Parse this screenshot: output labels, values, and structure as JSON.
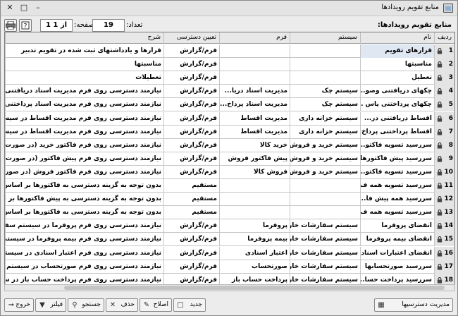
{
  "window": {
    "title": "منابع تقویم رویدادها"
  },
  "toolbar": {
    "form_caption": "منابع تقویم رویدادها:",
    "count_label": "تعداد:",
    "count_value": "19",
    "page_label": "صفحه:",
    "page_value": "1 از 1"
  },
  "columns": [
    "ردیف",
    "نام",
    "سیستم",
    "فرم",
    "تعیین دسترسی",
    "شرح"
  ],
  "rows": [
    {
      "idx": "1",
      "name": "قرارهای تقویم",
      "system": "",
      "form": "",
      "access": "فرم/گزارش",
      "desc": "قرارها و یادداشتهای ثبت شده در تقویم تدبیر"
    },
    {
      "idx": "2",
      "name": "مناسبتها",
      "system": "",
      "form": "",
      "access": "فرم/گزارش",
      "desc": "مناسبتها"
    },
    {
      "idx": "3",
      "name": "تعطیل",
      "system": "",
      "form": "",
      "access": "فرم/گزارش",
      "desc": "تعطیلات"
    },
    {
      "idx": "4",
      "name": "چکهای دریافتنی وصو...",
      "system": "سیستم چک",
      "form": "مدیریت اسناد دریا...",
      "access": "فرم/گزارش",
      "desc": "نیازمند دسترسی روی فرم مدیریت اسناد دریافتنی در سیستم چک"
    },
    {
      "idx": "5",
      "name": "چکهای پرداختنی پاس ...",
      "system": "سیستم چک",
      "form": "مدیریت اسناد پرداخ...",
      "access": "فرم/گزارش",
      "desc": "نیازمند دسترسی روی فرم مدیریت اسناد پرداختنی در سیستم چک"
    },
    {
      "idx": "6",
      "name": "اقساط دریافتنی در...",
      "system": "سیستم خزانه داری",
      "form": "مدیریت اقساط",
      "access": "فرم/گزارش",
      "desc": "نیازمند دسترسی روی فرم مدیریت اقساط در سیستم خزانه داری"
    },
    {
      "idx": "7",
      "name": "اقساط پرداختنی پرداخ...",
      "system": "سیستم خزانه داری",
      "form": "مدیریت اقساط",
      "access": "فرم/گزارش",
      "desc": "نیازمند دسترسی روی فرم مدیریت اقساط در سیستم خزانه داری"
    },
    {
      "idx": "8",
      "name": "سررسید تسویه فاکتو...",
      "system": "سیستم خرید و فروش",
      "form": "خرید کالا",
      "access": "فرم/گزارش",
      "desc": "نیازمند دسترسی روی فرم فاکتور خرید (در صورت فعال بودن گزینه"
    },
    {
      "idx": "9",
      "name": "سررسید پیش فاکتورها",
      "system": "سیستم خرید و فروش",
      "form": "پیش فاکتور فروش",
      "access": "فرم/گزارش",
      "desc": "نیازمند دسترسی روی فرم پیش فاکتور (در صورت فعال بودن گزینه"
    },
    {
      "idx": "10",
      "name": "سررسید تسویه فاکتو...",
      "system": "سیستم خرید و فروش",
      "form": "فروش کالا",
      "access": "فرم/گزارش",
      "desc": "نیازمند دسترسی روی فرم فاکتور فروش (در صورت فعال بودن گز"
    },
    {
      "idx": "11",
      "name": "سررسید تسویه همه ف...",
      "system": "",
      "form": "",
      "access": "مستقیم",
      "desc": "بدون توجه به گزینه دسترسی به فاکتورها بر اساس کاربر"
    },
    {
      "idx": "12",
      "name": "سررسید همه پیش فا...",
      "system": "",
      "form": "",
      "access": "مستقیم",
      "desc": "بدون توجه به گزینه دسترسی به پیش فاکتورها بر اساس کاربر"
    },
    {
      "idx": "13",
      "name": "سررسید تسویه همه ف...",
      "system": "",
      "form": "",
      "access": "مستقیم",
      "desc": "بدون توجه به گزینه دسترسی به فاکتورها بر اساس کاربر"
    },
    {
      "idx": "14",
      "name": "انقضای پروفرما",
      "system": "سیستم سفارشات خارجی",
      "form": "پروفرما",
      "access": "فرم/گزارش",
      "desc": "نیازمند دسترسی روی فرم پروفرما در سیستم سفارشات خارجی"
    },
    {
      "idx": "15",
      "name": "انقضای بیمه پروفرما",
      "system": "سیستم سفارشات خارجی",
      "form": "بیمه پروفرما",
      "access": "فرم/گزارش",
      "desc": "نیازمند دسترسی روی فرم بیمه پروفرما در سیستم سفارشات خارجی"
    },
    {
      "idx": "16",
      "name": "انقضای اعتبارات اسنادی",
      "system": "سیستم سفارشات خارجی",
      "form": "اعتبار اسنادی",
      "access": "فرم/گزارش",
      "desc": "نیازمند دسترسی روی فرم اعتبار اسنادی در سیستم سفارشات خار"
    },
    {
      "idx": "17",
      "name": "سررسید صورتحسابها",
      "system": "سیستم سفارشات خارجی",
      "form": "صورتحساب",
      "access": "فرم/گزارش",
      "desc": "نیازمند دسترسی روی فرم صورتحساب در سیستم سفارشات خارجی"
    },
    {
      "idx": "18",
      "name": "سررسید پرداخت حسا...",
      "system": "سیستم سفارشات خارجی",
      "form": "پرداخت حساب باز",
      "access": "فرم/گزارش",
      "desc": "نیازمند دسترسی روی فرم پرداخت حساب باز در سیستم سفارشات"
    },
    {
      "idx": "19",
      "name": "سررسید مهلت ارائه اسد...",
      "system": "سیستم سفارشات خارجی",
      "form": "بارنامه",
      "access": "فرم/گزارش",
      "desc": "نیازمند دسترسی روی فرم بارنامه در سیستم سفارشات خارجی"
    }
  ],
  "buttons": {
    "permissions": "مدیریت دسترسیها",
    "new": "جدید",
    "edit": "اصلاح",
    "delete": "حذف",
    "search": "جستجو",
    "filter": "فیلتر",
    "exit": "خروج"
  },
  "icons": {
    "print": "printer-icon",
    "help": "help-icon",
    "lock": "lock-icon"
  }
}
